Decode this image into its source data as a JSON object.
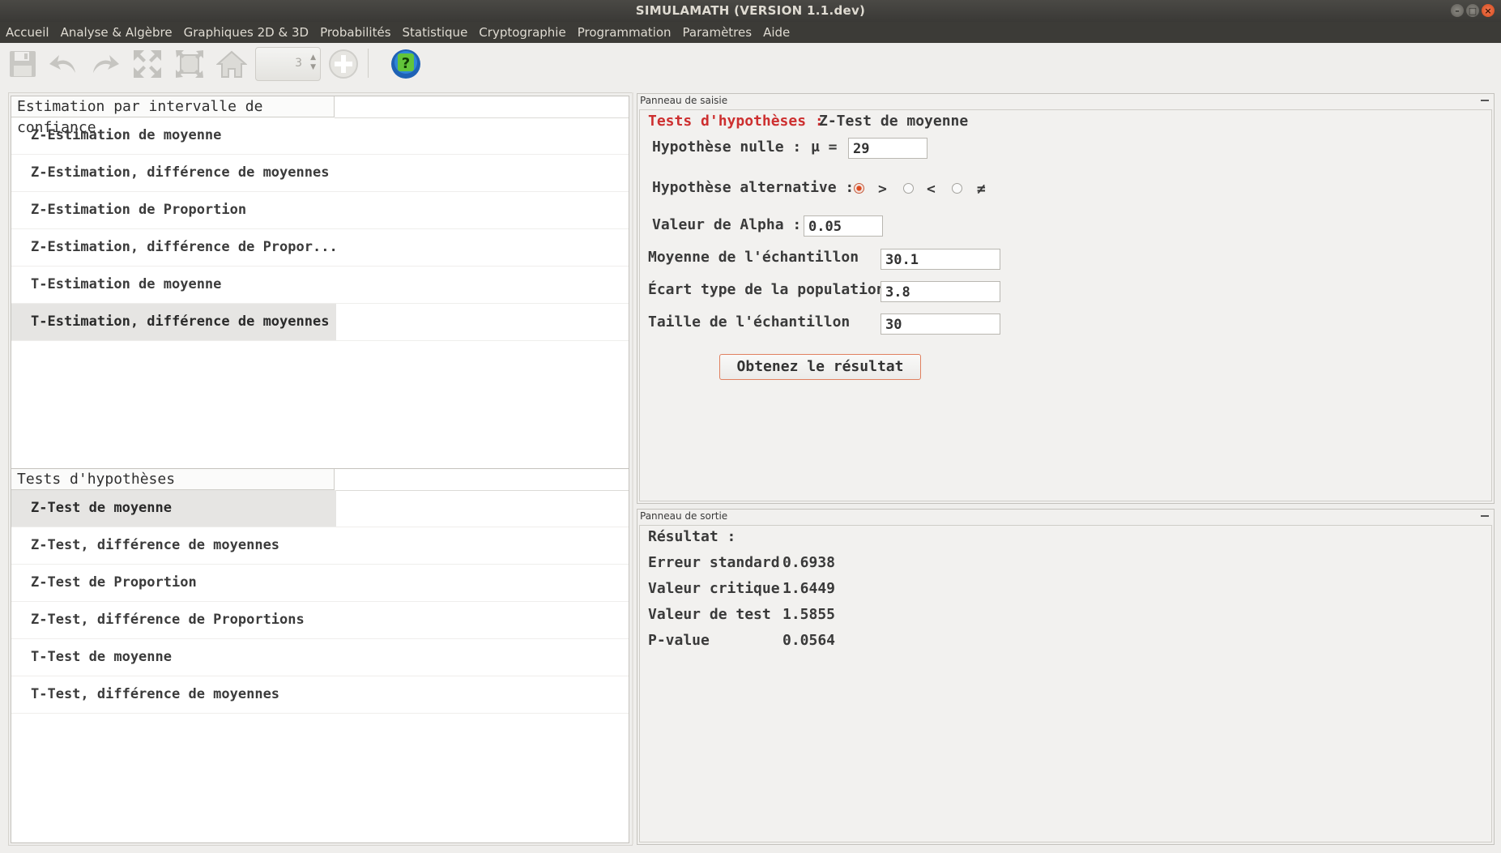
{
  "window": {
    "title": "SIMULAMATH   (VERSION 1.1.dev)"
  },
  "menu": [
    "Accueil",
    "Analyse & Algèbre",
    "Graphiques 2D & 3D",
    "Probabilités",
    "Statistique",
    "Cryptographie",
    "Programmation",
    "Paramètres",
    "Aide"
  ],
  "toolbar": {
    "icons": [
      "save-icon",
      "undo-icon",
      "redo-icon",
      "expand-icon",
      "fit-icon",
      "home-icon",
      "add-icon",
      "help-icon"
    ],
    "spinner_value": "3"
  },
  "estimation_panel": {
    "header": "Estimation par intervalle de confiance",
    "items": [
      "Z-Estimation de moyenne",
      "Z-Estimation, différence de moyennes",
      "Z-Estimation de Proportion",
      "Z-Estimation, différence de Propor...",
      "T-Estimation de moyenne",
      "T-Estimation, différence de moyennes"
    ],
    "selected_index": 5
  },
  "tests_panel": {
    "header": "Tests d'hypothèses",
    "items": [
      "Z-Test de moyenne",
      "Z-Test, différence de moyennes",
      "Z-Test de Proportion",
      "Z-Test, différence de Proportions",
      "T-Test de moyenne",
      "T-Test, différence de moyennes"
    ],
    "selected_index": 0
  },
  "input_panel": {
    "title": "Panneau de saisie",
    "heading_red": "Tests d'hypothèses :",
    "heading_black": "Z-Test de moyenne",
    "null_hypothesis_label": "Hypothèse nulle :",
    "mu_label": "μ =",
    "mu_value": "29",
    "alternative_label": "Hypothèse alternative :",
    "alternative_options": [
      ">",
      "<",
      "≠"
    ],
    "alternative_selected": ">",
    "alpha_label": "Valeur de Alpha :",
    "alpha_value": "0.05",
    "sample_mean_label": "Moyenne de l'échantillon",
    "sample_mean_value": "30.1",
    "pop_sd_label": "Écart type de la population",
    "pop_sd_value": "3.8",
    "sample_size_label": "Taille de l'échantillon",
    "sample_size_value": "30",
    "submit_label": "Obtenez le résultat"
  },
  "output_panel": {
    "title": "Panneau de sortie",
    "result_label": "Résultat :",
    "rows": [
      {
        "label": "Erreur standard",
        "value": "0.6938"
      },
      {
        "label": "Valeur critique",
        "value": "1.6449"
      },
      {
        "label": "Valeur de test",
        "value": "1.5855"
      },
      {
        "label": "P-value",
        "value": "0.0564"
      }
    ]
  }
}
